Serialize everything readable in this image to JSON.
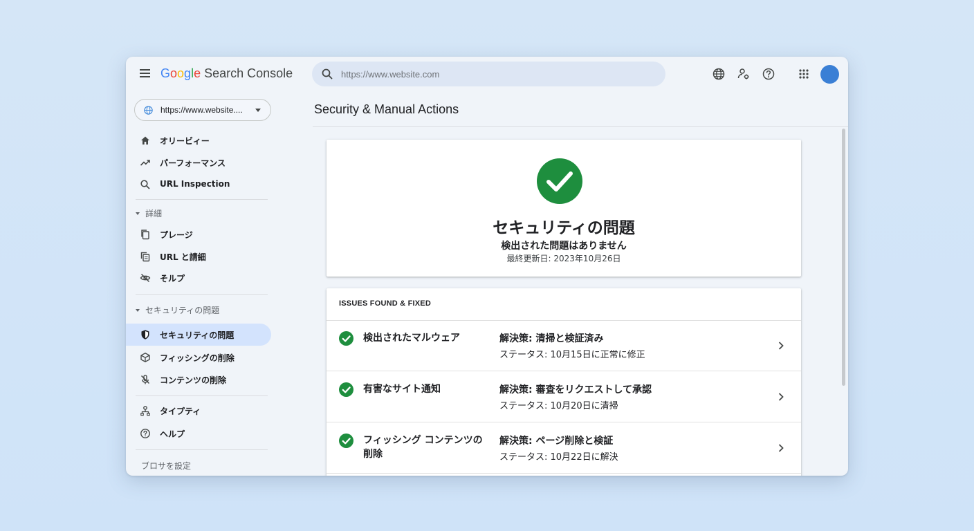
{
  "app": {
    "logo_letters": [
      "G",
      "o",
      "o",
      "g",
      "l",
      "e"
    ],
    "product_name": "Search Console"
  },
  "search": {
    "placeholder": "https://www.website.com"
  },
  "toolbar_icons": [
    "globe-icon",
    "admin-settings-icon",
    "help-icon",
    "apps-grid-icon",
    "avatar"
  ],
  "property": {
    "label": "https://www.website...."
  },
  "sidebar": {
    "top_items": [
      {
        "label": "オリービィー",
        "icon": "home-icon"
      },
      {
        "label": "パーフォーマンス",
        "icon": "trending-icon"
      },
      {
        "label": "URL Inspection",
        "icon": "search-icon"
      }
    ],
    "section1": {
      "title": "詳細",
      "items": [
        {
          "label": "プレージ",
          "icon": "pages-icon"
        },
        {
          "label": "URL と請細",
          "icon": "url-copy-icon"
        },
        {
          "label": "そルプ",
          "icon": "hidden-icon"
        }
      ]
    },
    "section2": {
      "title": "セキュリティの問題",
      "items": [
        {
          "label": "セキュリティの問題",
          "icon": "shield-icon",
          "active": true
        },
        {
          "label": "フィッシングの削除",
          "icon": "cube-icon"
        },
        {
          "label": "コンテンツの削除",
          "icon": "mic-off-icon"
        }
      ]
    },
    "bottom_items": [
      {
        "label": "タイプティ",
        "icon": "person-tree-icon"
      },
      {
        "label": "ヘルプ",
        "icon": "help-icon"
      }
    ],
    "footer_text": "ブロサを設定"
  },
  "main": {
    "page_title": "Security & Manual Actions",
    "status": {
      "title": "セキュリティの問題",
      "subtitle": "検出された問題はありません",
      "last_updated": "最終更新日: 2023年10月26日"
    },
    "issues": {
      "header": "ISSUES FOUND & FIXED",
      "rows": [
        {
          "name": "検出されたマルウェア",
          "resolution": "解決策: 清掃と検証済み",
          "status": "ステータス: 10月15日に正常に修正"
        },
        {
          "name": "有害なサイト通知",
          "resolution": "解決策: 審査をリクエストして承認",
          "status": "ステータス: 10月20日に清掃"
        },
        {
          "name": "フィッシング コンテンツの削除",
          "resolution": "解決策: ページ削除と検証",
          "status": "ステータス: 10月22日に解決"
        }
      ]
    }
  },
  "colors": {
    "success": "#1e8e3e",
    "active_nav": "#d3e3fd",
    "avatar": "#3a7fd5",
    "search_bg": "#dde6f4"
  }
}
